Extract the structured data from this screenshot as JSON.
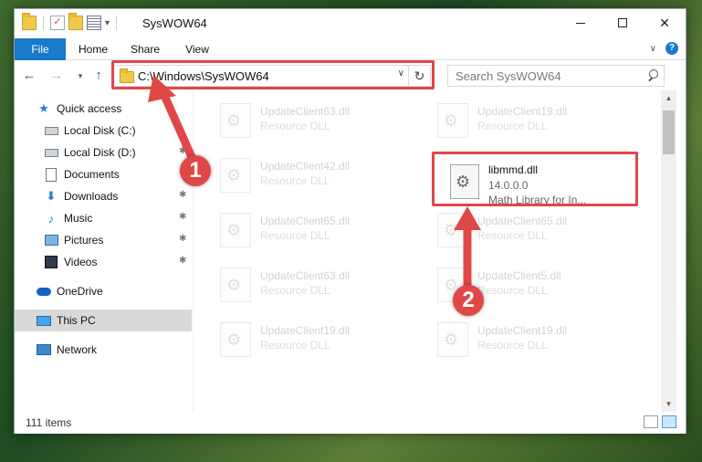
{
  "window": {
    "title": "SysWOW64"
  },
  "ribbon": {
    "tabs": [
      {
        "label": "File"
      },
      {
        "label": "Home"
      },
      {
        "label": "Share"
      },
      {
        "label": "View"
      }
    ]
  },
  "navbar": {
    "address": "C:\\Windows\\SysWOW64",
    "search_placeholder": "Search SysWOW64"
  },
  "sidebar": {
    "items": [
      {
        "label": "Quick access",
        "icon": "star-icon"
      },
      {
        "label": "Local Disk (C:)",
        "icon": "drive-icon"
      },
      {
        "label": "Local Disk (D:)",
        "icon": "drive-icon"
      },
      {
        "label": "Documents",
        "icon": "document-icon"
      },
      {
        "label": "Downloads",
        "icon": "download-icon"
      },
      {
        "label": "Music",
        "icon": "music-icon"
      },
      {
        "label": "Pictures",
        "icon": "picture-icon"
      },
      {
        "label": "Videos",
        "icon": "video-icon"
      },
      {
        "label": "OneDrive",
        "icon": "cloud-icon"
      },
      {
        "label": "This PC",
        "icon": "computer-icon"
      },
      {
        "label": "Network",
        "icon": "network-icon"
      }
    ]
  },
  "files": {
    "background": [
      {
        "name": "UpdateClient63.dll",
        "desc": "Resource DLL"
      },
      {
        "name": "UpdateClient19.dll",
        "desc": "Resource DLL"
      },
      {
        "name": "UpdateClient42.dll",
        "desc": "Resource DLL"
      },
      {
        "name": "UpdateClient65.dll",
        "desc": "Resource DLL"
      },
      {
        "name": "UpdateClient65.dll",
        "desc": "Resource DLL"
      },
      {
        "name": "UpdateClient63.dll",
        "desc": "Resource DLL"
      },
      {
        "name": "UpdateClient5.dll",
        "desc": "Resource DLL"
      },
      {
        "name": "UpdateClient19.dll",
        "desc": "Resource DLL"
      },
      {
        "name": "UpdateClient19.dll",
        "desc": "Resource DLL"
      }
    ],
    "selected": {
      "name": "libmmd.dll",
      "version": "14.0.0.0",
      "desc": "Math Library for In..."
    }
  },
  "status": {
    "item_count": "111 items"
  },
  "annotations": {
    "step1": "1",
    "step2": "2",
    "color": "#e04848"
  }
}
